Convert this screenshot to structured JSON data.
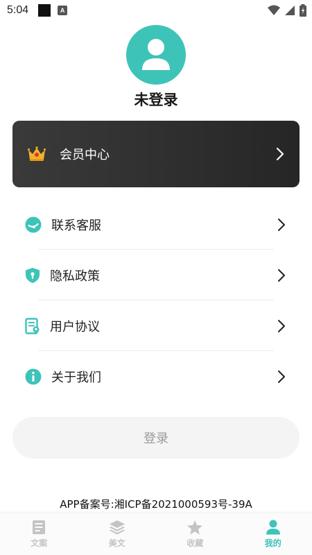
{
  "status_bar": {
    "time": "5:04",
    "notif_letter": "A"
  },
  "profile": {
    "name": "未登录",
    "avatar_icon": "user-icon"
  },
  "member": {
    "label": "会员中心",
    "icon": "crown-icon"
  },
  "menu": [
    {
      "label": "联系客服",
      "icon": "customer-service-icon"
    },
    {
      "label": "隐私政策",
      "icon": "shield-keyhole-icon"
    },
    {
      "label": "用户协议",
      "icon": "document-agreement-icon"
    },
    {
      "label": "关于我们",
      "icon": "info-icon"
    }
  ],
  "login_button": {
    "label": "登录"
  },
  "filing": "APP备案号:湘ICP备2021000593号-39A",
  "tabs": [
    {
      "label": "文案",
      "icon": "document-icon",
      "active": false
    },
    {
      "label": "美文",
      "icon": "layers-icon",
      "active": false
    },
    {
      "label": "收藏",
      "icon": "star-icon",
      "active": false
    },
    {
      "label": "我的",
      "icon": "person-icon",
      "active": true
    }
  ],
  "colors": {
    "accent": "#3ec3b9",
    "card_bg": "#2b2b2b",
    "inactive": "#c4c4c4"
  }
}
